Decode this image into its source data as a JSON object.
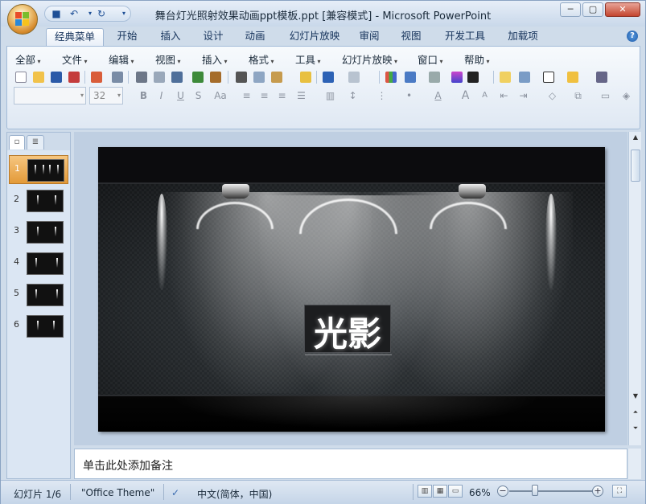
{
  "window": {
    "title": "舞台灯光照射效果动画ppt模板.ppt [兼容模式] - Microsoft PowerPoint",
    "controls": [
      "─",
      "▢",
      "✕"
    ]
  },
  "qat": {
    "save": "■",
    "undo": "↶",
    "redo": "↻",
    "more": "▾"
  },
  "tabs": [
    "经典菜单",
    "开始",
    "插入",
    "设计",
    "动画",
    "幻灯片放映",
    "审阅",
    "视图",
    "开发工具",
    "加载项"
  ],
  "active_tab": "经典菜单",
  "help_label": "?",
  "menus": [
    "全部",
    "文件",
    "编辑",
    "视图",
    "插入",
    "格式",
    "工具",
    "幻灯片放映",
    "窗口",
    "帮助"
  ],
  "formatting": {
    "font_name": "",
    "font_size": "32",
    "bold": "B",
    "italic": "I",
    "underline": "U",
    "strike": "S",
    "change_case": "Aa",
    "font_color": "A",
    "grow": "A",
    "shrink": "A"
  },
  "slides": [
    {
      "num": "1",
      "selected": true
    },
    {
      "num": "2",
      "selected": false
    },
    {
      "num": "3",
      "selected": false
    },
    {
      "num": "4",
      "selected": false
    },
    {
      "num": "5",
      "selected": false
    },
    {
      "num": "6",
      "selected": false
    }
  ],
  "slide": {
    "title": "光影"
  },
  "notes": {
    "placeholder": "单击此处添加备注"
  },
  "status": {
    "slide_info": "幻灯片 1/6",
    "theme": "\"Office Theme\"",
    "language": "中文(简体，中国)",
    "zoom": "66%",
    "zoom_level": 0.66
  },
  "colors": {
    "accent": "#e39a38",
    "ribbon": "#dfe8f3",
    "slide_bg": "#0c0c0e"
  }
}
